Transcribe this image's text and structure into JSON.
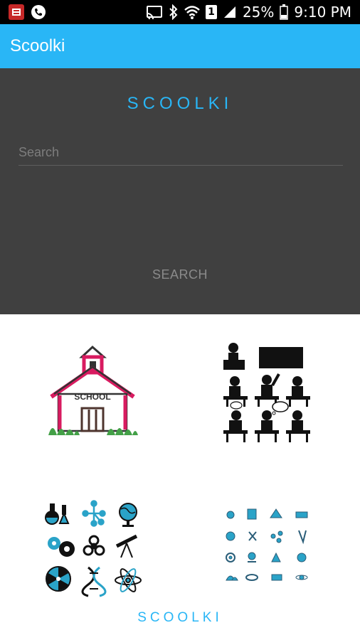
{
  "status_bar": {
    "battery": "25%",
    "time": "9:10 PM",
    "sim_slot": "1"
  },
  "app_bar": {
    "title": "Scoolki"
  },
  "search_panel": {
    "brand": "SCOOLKI",
    "search_placeholder": "Search",
    "search_value": "",
    "search_button_label": "SEARCH"
  },
  "tiles": {
    "school_house_label": "SCHOOL"
  },
  "footer": {
    "brand": "SCOOLKI"
  },
  "colors": {
    "accent": "#29b6f6",
    "panel_bg": "#404040",
    "school_roof": "#d81b60",
    "grass": "#43a047",
    "science_blue": "#2aa3c8"
  }
}
